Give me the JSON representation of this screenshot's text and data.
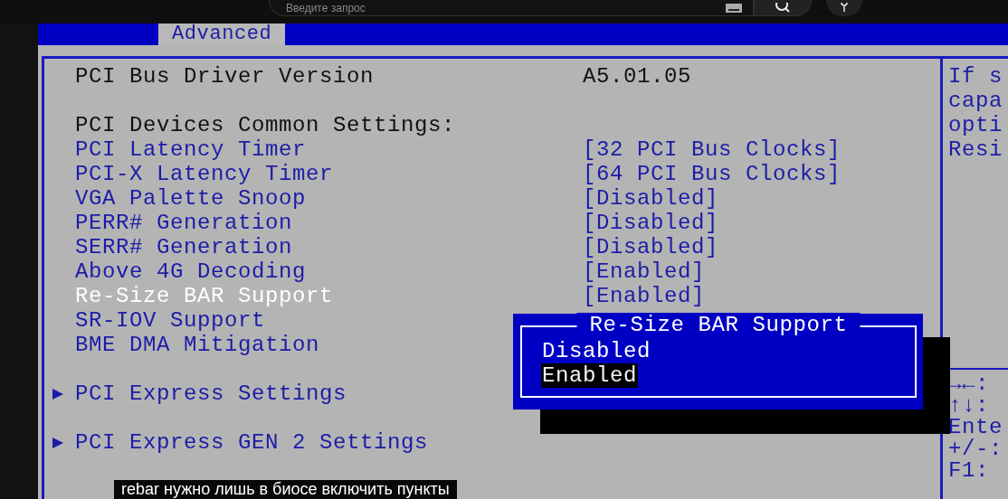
{
  "top_bar": {
    "search": {
      "placeholder": "Введите запрос"
    }
  },
  "tabs": [
    {
      "label": "Advanced",
      "selected": true
    }
  ],
  "sections": [
    {
      "items": [
        {
          "kind": "info",
          "label": "PCI Bus Driver Version",
          "value": "A5.01.05",
          "selected": false
        }
      ]
    },
    {
      "items": [
        {
          "kind": "heading",
          "label": "PCI Devices Common Settings:",
          "selected": false
        },
        {
          "kind": "setting",
          "label": "PCI Latency Timer",
          "value": "[32 PCI Bus Clocks]",
          "selected": false
        },
        {
          "kind": "setting",
          "label": "PCI-X Latency Timer",
          "value": "[64 PCI Bus Clocks]",
          "selected": false
        },
        {
          "kind": "setting",
          "label": "VGA Palette Snoop",
          "value": "[Disabled]",
          "selected": false
        },
        {
          "kind": "setting",
          "label": "PERR# Generation",
          "value": "[Disabled]",
          "selected": false
        },
        {
          "kind": "setting",
          "label": "SERR# Generation",
          "value": "[Disabled]",
          "selected": false
        },
        {
          "kind": "setting",
          "label": "Above 4G Decoding",
          "value": "[Enabled]",
          "selected": false
        },
        {
          "kind": "setting",
          "label": "Re-Size BAR Support",
          "value": "[Enabled]",
          "selected": true
        },
        {
          "kind": "setting",
          "label": "SR-IOV Support",
          "selected": false
        },
        {
          "kind": "setting",
          "label": "BME DMA Mitigation",
          "selected": false
        }
      ]
    },
    {
      "items": [
        {
          "kind": "submenu",
          "label": "PCI Express Settings",
          "selected": false
        }
      ]
    },
    {
      "items": [
        {
          "kind": "submenu",
          "label": "PCI Express GEN 2 Settings",
          "selected": false
        }
      ]
    }
  ],
  "popup": {
    "title": "Re-Size BAR Support",
    "options": [
      {
        "label": "Disabled",
        "selected": false
      },
      {
        "label": "Enabled",
        "selected": true
      }
    ]
  },
  "help": {
    "lines": [
      "If s",
      "capa",
      "opti",
      "Resi"
    ],
    "keys": [
      "→←:",
      "↑↓:",
      "Ente",
      "+/-:",
      "F1:"
    ]
  },
  "caption": "rebar нужно лишь в биосе включить пункты"
}
